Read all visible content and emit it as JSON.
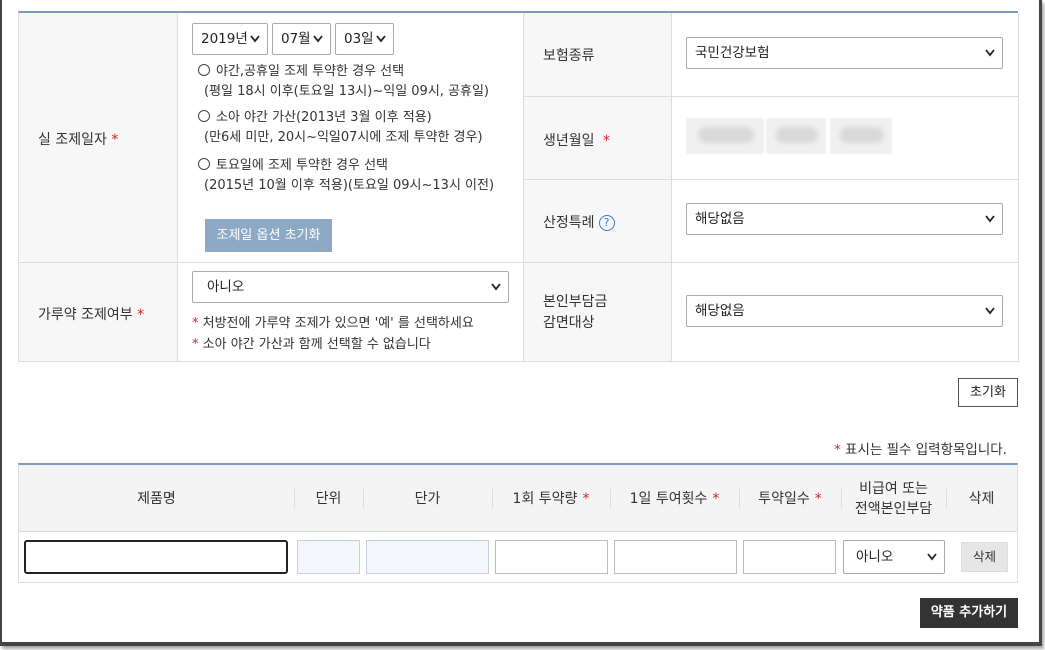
{
  "dispense_date": {
    "label": "실 조제일자",
    "required_mark": "*",
    "year": "2019년",
    "month": "07월",
    "day": "03일",
    "options": [
      {
        "line1": "야간,공휴일 조제 투약한 경우 선택",
        "line2": "(평일 18시 이후(토요일 13시)~익일 09시, 공휴일)"
      },
      {
        "line1": "소아 야간 가산(2013년 3월 이후 적용)",
        "line2": "(만6세 미만, 20시~익일07시에 조제 투약한 경우)"
      },
      {
        "line1": "토요일에 조제 투약한 경우 선택",
        "line2": "(2015년 10월 이후 적용)(토요일 09시~13시 이전)"
      }
    ],
    "reset_option_label": "조제일 옵션 초기화"
  },
  "insurance_type": {
    "label": "보험종류",
    "value": "국민건강보험"
  },
  "birth_date": {
    "label": "생년월일",
    "required_mark": "*"
  },
  "special_case": {
    "label": "산정특례",
    "help_icon": "?",
    "value": "해당없음"
  },
  "powder": {
    "label": "가루약 조제여부",
    "required_mark": "*",
    "value": "아니오",
    "note1": "처방전에 가루약 조제가 있으면 '예' 를 선택하세요",
    "note2": "소아 야간 가산과 함께 선택할 수 없습니다",
    "note_mark": "*"
  },
  "copay_reduction": {
    "label_line1": "본인부담금",
    "label_line2": "감면대상",
    "value": "해당없음"
  },
  "reset_label": "초기화",
  "required_note": {
    "mark": "*",
    "text": "표시는 필수 입력항목입니다."
  },
  "grid": {
    "headers": {
      "product": "제품명",
      "unit": "단위",
      "price": "단가",
      "dose": "1회 투약량",
      "daily": "1일 투여횟수",
      "days": "투약일수",
      "nonpay_line1": "비급여 또는",
      "nonpay_line2": "전액본인부담",
      "delete": "삭제"
    },
    "required_mark": "*",
    "row": {
      "nonpay_value": "아니오",
      "delete_label": "삭제"
    }
  },
  "add_drug_label": "약품 추가하기",
  "colors": {
    "accent_border": "#7a9bbd",
    "button_blue": "#8ea9c6",
    "required": "#d2232a",
    "dark_button": "#333333"
  }
}
